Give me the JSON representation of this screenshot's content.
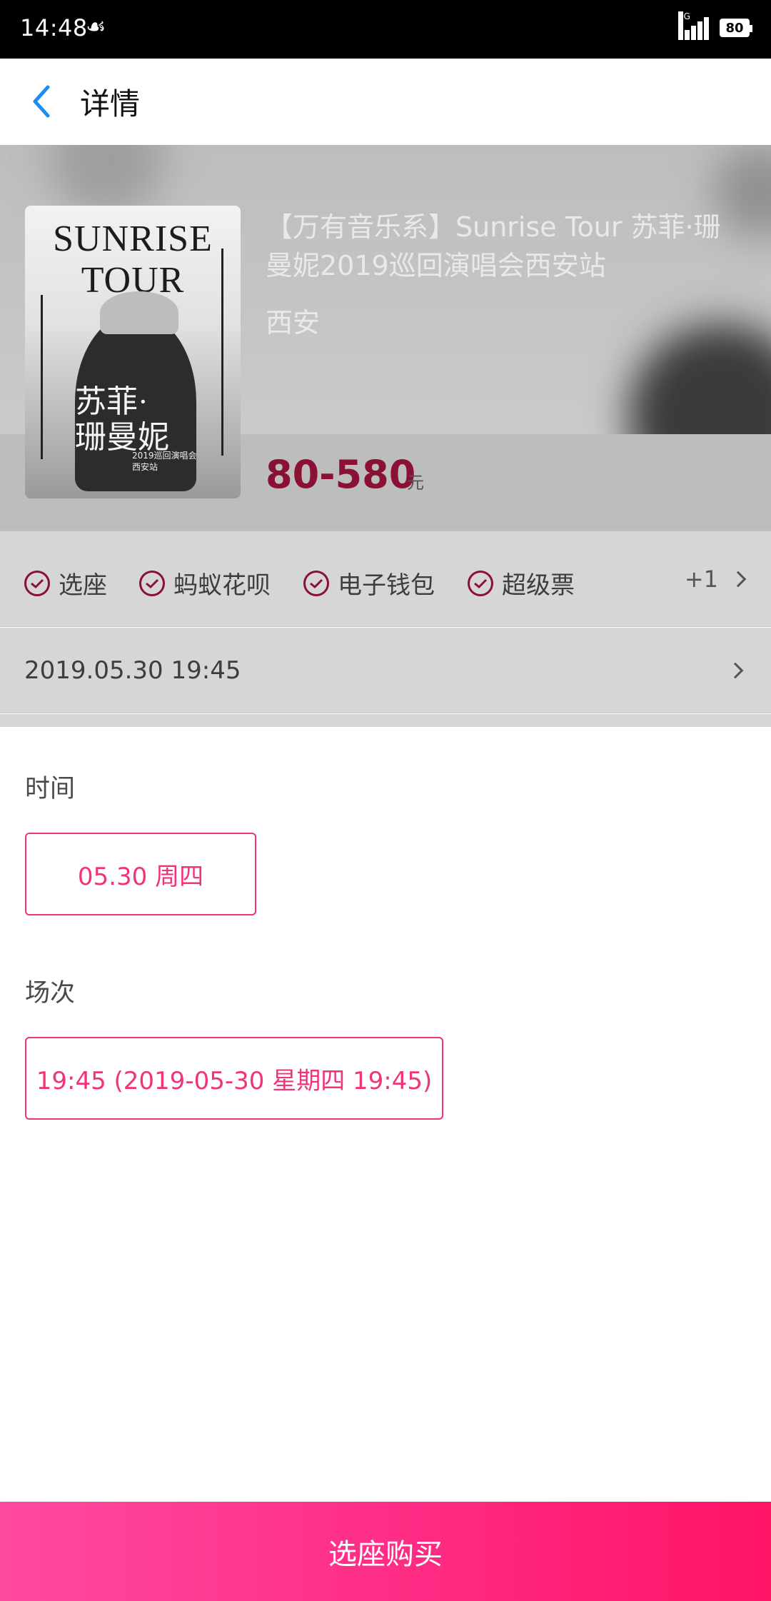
{
  "status_bar": {
    "time": "14:48",
    "network": "4G",
    "battery": "80"
  },
  "header": {
    "title": "详情"
  },
  "event": {
    "poster": {
      "title_line1": "SUNRISE",
      "title_line2": "TOUR",
      "cn_line1": "苏菲·",
      "cn_line2": "珊曼妮",
      "sub_line1": "2019巡回演唱会",
      "sub_line2": "西安站"
    },
    "title": "【万有音乐系】Sunrise Tour 苏菲·珊曼妮2019巡回演唱会西安站",
    "city": "西安",
    "price": "80-580",
    "price_unit": "元"
  },
  "tags": [
    {
      "label": "选座"
    },
    {
      "label": "蚂蚁花呗"
    },
    {
      "label": "电子钱包"
    },
    {
      "label": "超级票"
    }
  ],
  "tags_more": "+1",
  "session_date": "2019.05.30 19:45",
  "selector": {
    "time_label": "时间",
    "time_option": "05.30 周四",
    "session_label": "场次",
    "session_option": "19:45 (2019-05-30 星期四 19:45)"
  },
  "buy_button": "选座购买",
  "colors": {
    "accent": "#f0337a",
    "price": "#8a1034",
    "button_start": "#ff4aa0",
    "button_end": "#ff1466"
  }
}
